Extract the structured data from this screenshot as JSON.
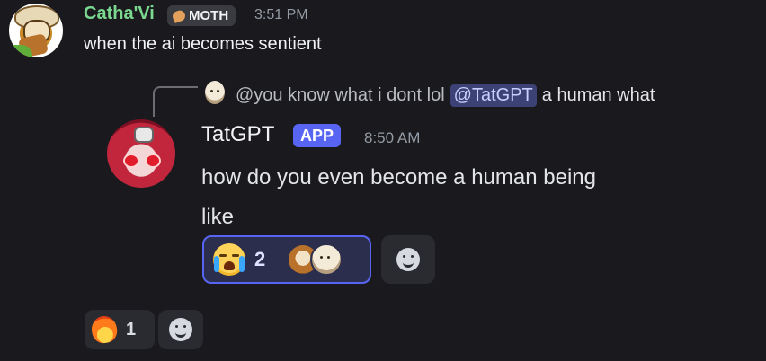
{
  "messages": [
    {
      "author": "Catha'Vi",
      "badge": "MOTH",
      "time": "3:51 PM",
      "content": "when the ai becomes sentient",
      "reactions": [
        {
          "emoji": "fire",
          "count": "1"
        }
      ]
    },
    {
      "reply_preview": {
        "text": "@you know what i dont lol",
        "mention": "@TatGPT",
        "after": "a human what"
      },
      "author": "TatGPT",
      "badge": "APP",
      "time": "8:50 AM",
      "content": "how do you even become a human being\nlike",
      "reactions": [
        {
          "emoji": "loudly-crying-face",
          "count": "2"
        }
      ]
    }
  ],
  "colors": {
    "background": "#1a1a1e",
    "username_green": "#7bd88f",
    "mention_bg": "#3c4275",
    "app_badge": "#5865f2",
    "reaction_selected_bg": "#2b2f4d"
  },
  "icons": [
    "moth-badge-icon",
    "loudly-crying-face-icon",
    "fire-icon",
    "add-reaction-icon"
  ]
}
